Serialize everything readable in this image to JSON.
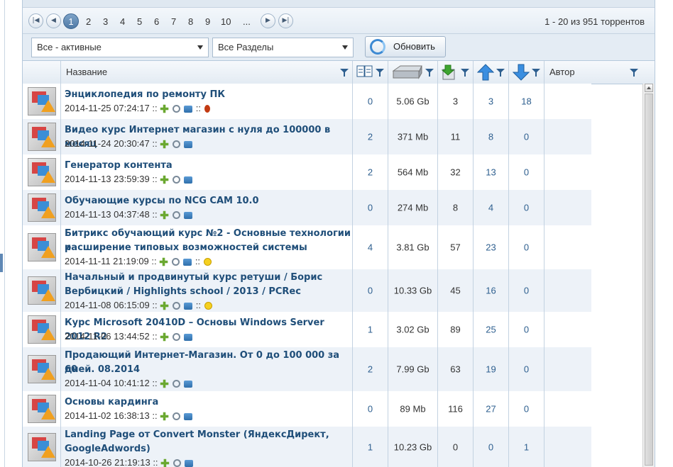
{
  "pager": {
    "pages": [
      "1",
      "2",
      "3",
      "4",
      "5",
      "6",
      "7",
      "8",
      "9",
      "10",
      "..."
    ],
    "active_page": "1",
    "summary": "1 - 20 из 951 торрентов"
  },
  "filters": {
    "status": "Все - активные",
    "section": "Все Разделы",
    "refresh_label": "Обновить"
  },
  "columns": {
    "name": "Название",
    "author": "Автор"
  },
  "rows": [
    {
      "title_lines": [
        "Энциклопедия по ремонту ПК"
      ],
      "date": "2014-11-25 07:24:17 ::",
      "extra": "bug",
      "comments": "0",
      "size": "5.06 Gb",
      "completed": "3",
      "seeders": "3",
      "leechers": "18"
    },
    {
      "title_lines": [
        "Видео курс Интернет магазин с нуля до 100000 в месяц"
      ],
      "date": "2014-11-24 20:30:47 ::",
      "extra": "",
      "comments": "2",
      "size": "371 Mb",
      "completed": "11",
      "seeders": "8",
      "leechers": "0"
    },
    {
      "title_lines": [
        "Генератор контента"
      ],
      "date": "2014-11-13 23:59:39 ::",
      "extra": "",
      "comments": "2",
      "size": "564 Mb",
      "completed": "32",
      "seeders": "13",
      "leechers": "0"
    },
    {
      "title_lines": [
        "Обучающие курсы по NCG CAM 10.0"
      ],
      "date": "2014-11-13 04:37:48 ::",
      "extra": "",
      "comments": "0",
      "size": "274 Mb",
      "completed": "8",
      "seeders": "4",
      "leechers": "0"
    },
    {
      "title_lines": [
        "Битрикс обучающий курс №2 - Основные технологии и",
        "расширение типовых возможностей системы"
      ],
      "date": "2014-11-11 21:19:09 ::",
      "extra": "smile",
      "comments": "4",
      "size": "3.81 Gb",
      "completed": "57",
      "seeders": "23",
      "leechers": "0"
    },
    {
      "title_lines": [
        "Начальный и продвинутый курс ретуши / Борис",
        "Вербицкий / Highlights school / 2013 / PCRec"
      ],
      "date": "2014-11-08 06:15:09 ::",
      "extra": "smile",
      "comments": "0",
      "size": "10.33 Gb",
      "completed": "45",
      "seeders": "16",
      "leechers": "0"
    },
    {
      "title_lines": [
        "Курс Microsoft 20410D – Основы Windows Server 2012 R2"
      ],
      "date": "2014-11-06 13:44:52 ::",
      "extra": "",
      "comments": "1",
      "size": "3.02 Gb",
      "completed": "89",
      "seeders": "25",
      "leechers": "0"
    },
    {
      "title_lines": [
        "Продающий Интернет-Магазин. От 0 до 100 000 за 60",
        "дней. 08.2014"
      ],
      "date": "2014-11-04 10:41:12 ::",
      "extra": "",
      "comments": "2",
      "size": "7.99 Gb",
      "completed": "63",
      "seeders": "19",
      "leechers": "0"
    },
    {
      "title_lines": [
        "Основы кардинга"
      ],
      "date": "2014-11-02 16:38:13 ::",
      "extra": "",
      "comments": "0",
      "size": "89 Mb",
      "completed": "116",
      "seeders": "27",
      "leechers": "0"
    },
    {
      "title_lines": [
        "Landing Page от Convert Monster (ЯндексДирект,",
        "GoogleAdwords)"
      ],
      "date": "2014-10-26 21:19:13 ::",
      "extra": "",
      "comments": "1",
      "size": "10.23 Gb",
      "completed": "0",
      "seeders": "0",
      "leechers": "1"
    }
  ]
}
